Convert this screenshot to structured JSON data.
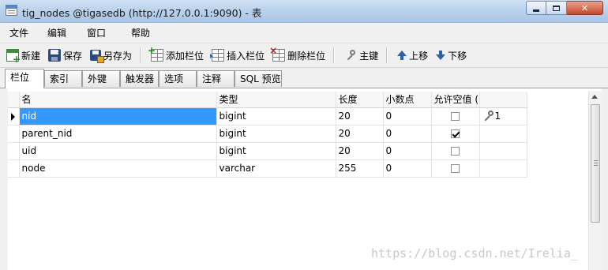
{
  "window": {
    "title": "tig_nodes @tigasedb (http://127.0.0.1:9090) - 表"
  },
  "menu": [
    "文件",
    "编辑",
    "窗口",
    "帮助"
  ],
  "toolbar": {
    "new": "新建",
    "save": "保存",
    "save_as": "另存为",
    "add_column": "添加栏位",
    "insert_column": "插入栏位",
    "delete_column": "删除栏位",
    "primary_key": "主键",
    "move_up": "上移",
    "move_down": "下移"
  },
  "tabs": [
    "栏位",
    "索引",
    "外键",
    "触发器",
    "选项",
    "注释",
    "SQL 预览"
  ],
  "active_tab": "栏位",
  "grid": {
    "headers": [
      "名",
      "类型",
      "长度",
      "小数点",
      "允许空值 ("
    ],
    "rows": [
      {
        "name": "nid",
        "type": "bigint",
        "length": "20",
        "decimals": "0",
        "allow_null": false,
        "key": "1",
        "selected": true
      },
      {
        "name": "parent_nid",
        "type": "bigint",
        "length": "20",
        "decimals": "0",
        "allow_null": true,
        "key": "",
        "selected": false
      },
      {
        "name": "uid",
        "type": "bigint",
        "length": "20",
        "decimals": "0",
        "allow_null": false,
        "key": "",
        "selected": false
      },
      {
        "name": "node",
        "type": "varchar",
        "length": "255",
        "decimals": "0",
        "allow_null": false,
        "key": "",
        "selected": false
      }
    ]
  },
  "watermark": "https://blog.csdn.net/Irelia_"
}
